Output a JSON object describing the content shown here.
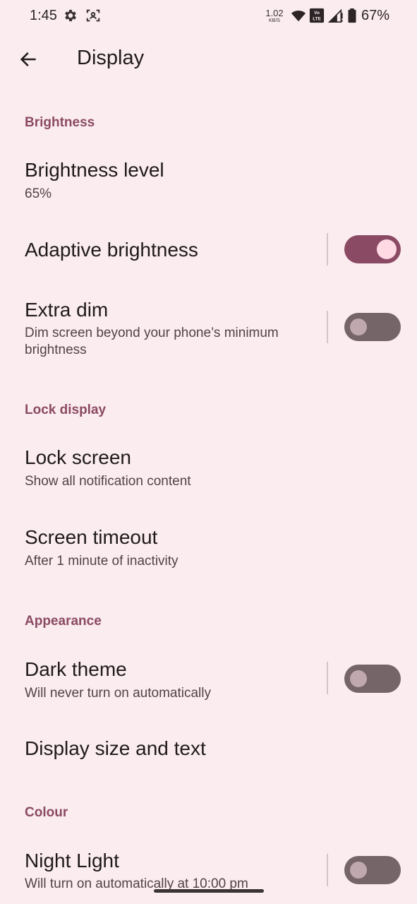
{
  "status_bar": {
    "time": "1:45",
    "net_speed": "1.02",
    "net_unit": "KB/S",
    "battery": "67%",
    "icons": [
      "gear-icon",
      "face-scan-icon",
      "wifi-icon",
      "volte-icon",
      "signal-icon",
      "battery-icon"
    ]
  },
  "app_bar": {
    "title": "Display",
    "back_icon": "arrow-back-icon"
  },
  "sections": {
    "brightness": {
      "header": "Brightness",
      "brightness_level": {
        "title": "Brightness level",
        "value": "65%"
      },
      "adaptive": {
        "title": "Adaptive brightness",
        "enabled": true
      },
      "extra_dim": {
        "title": "Extra dim",
        "subtitle": "Dim screen beyond your phone’s minimum brightness",
        "enabled": false
      }
    },
    "lock_display": {
      "header": "Lock display",
      "lock_screen": {
        "title": "Lock screen",
        "subtitle": "Show all notification content"
      },
      "screen_timeout": {
        "title": "Screen timeout",
        "subtitle": "After 1 minute of inactivity"
      }
    },
    "appearance": {
      "header": "Appearance",
      "dark_theme": {
        "title": "Dark theme",
        "subtitle": "Will never turn on automatically",
        "enabled": false
      },
      "display_size": {
        "title": "Display size and text"
      }
    },
    "colour": {
      "header": "Colour",
      "night_light": {
        "title": "Night Light",
        "subtitle": "Will turn on automatically at 10:00 pm",
        "enabled": false
      }
    }
  },
  "colors": {
    "background": "#FAECEF",
    "accent": "#8B4A63",
    "switch_off_track": "#756468",
    "switch_on_thumb": "#FFD9E3"
  }
}
